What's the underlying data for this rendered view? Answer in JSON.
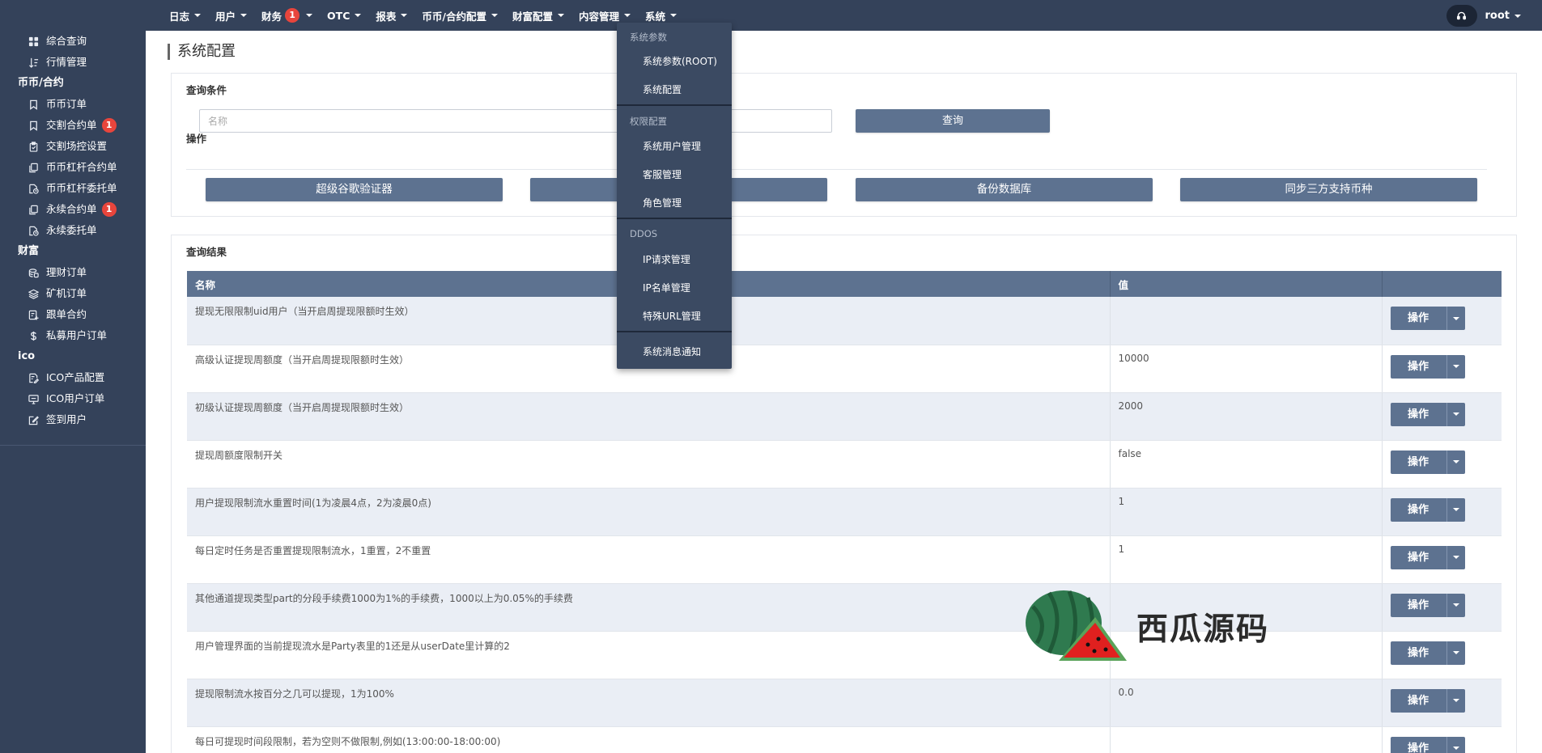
{
  "sidebar": {
    "items": [
      {
        "type": "item",
        "label": "综合查询",
        "icon": "dashboard-icon"
      },
      {
        "type": "item",
        "label": "行情管理",
        "icon": "sort-icon"
      },
      {
        "type": "section",
        "label": "币币/合约"
      },
      {
        "type": "item",
        "label": "币币订单",
        "icon": "bookmark-icon"
      },
      {
        "type": "item",
        "label": "交割合约单",
        "icon": "bookmark-icon",
        "badge": "1"
      },
      {
        "type": "item",
        "label": "交割场控设置",
        "icon": "clipboard-icon"
      },
      {
        "type": "item",
        "label": "币币杠杆合约单",
        "icon": "copy-icon"
      },
      {
        "type": "item",
        "label": "币币杠杆委托单",
        "icon": "file-clock-icon"
      },
      {
        "type": "item",
        "label": "永续合约单",
        "icon": "copy-icon",
        "badge": "1"
      },
      {
        "type": "item",
        "label": "永续委托单",
        "icon": "file-clock-icon"
      },
      {
        "type": "section",
        "label": "财富"
      },
      {
        "type": "item",
        "label": "理财订单",
        "icon": "coins-icon"
      },
      {
        "type": "item",
        "label": "矿机订单",
        "icon": "layers-icon"
      },
      {
        "type": "item",
        "label": "跟单合约",
        "icon": "file-plus-icon"
      },
      {
        "type": "item",
        "label": "私募用户订单",
        "icon": "dollar-icon"
      },
      {
        "type": "section",
        "label": "ico"
      },
      {
        "type": "item",
        "label": "ICO产品配置",
        "icon": "file-edit-icon"
      },
      {
        "type": "item",
        "label": "ICO用户订单",
        "icon": "monitor-icon"
      },
      {
        "type": "item",
        "label": "签到用户",
        "icon": "checkbox-edit-icon"
      }
    ]
  },
  "topnav": [
    {
      "label": "日志",
      "caret": true
    },
    {
      "label": "用户",
      "caret": true
    },
    {
      "label": "财务",
      "caret": true,
      "badge": "1"
    },
    {
      "label": "OTC",
      "caret": true
    },
    {
      "label": "报表",
      "caret": true
    },
    {
      "label": "币币/合约配置",
      "caret": true
    },
    {
      "label": "财富配置",
      "caret": true
    },
    {
      "label": "内容管理",
      "caret": true
    },
    {
      "label": "系统",
      "caret": true
    }
  ],
  "user": {
    "name": "root",
    "icon": "headset-icon"
  },
  "page": {
    "title": "系统配置"
  },
  "query": {
    "section_title": "查询条件",
    "placeholder": "名称",
    "query_button": "查询"
  },
  "operations": {
    "section_title": "操作",
    "buttons": [
      "超级谷歌验证器",
      "",
      "备份数据库",
      "同步三方支持币种"
    ]
  },
  "results": {
    "section_title": "查询结果",
    "columns": [
      "名称",
      "值",
      ""
    ],
    "action_label": "操作",
    "rows": [
      {
        "name": "提现无限限制uid用户（当开启周提现限额时生效）",
        "value": ""
      },
      {
        "name": "高级认证提现周额度（当开启周提现限额时生效）",
        "value": "10000"
      },
      {
        "name": "初级认证提现周额度（当开启周提现限额时生效）",
        "value": "2000"
      },
      {
        "name": "提现周额度限制开关",
        "value": "false"
      },
      {
        "name": "用户提现限制流水重置时间(1为凌晨4点，2为凌晨0点)",
        "value": "1"
      },
      {
        "name": "每日定时任务是否重置提现限制流水，1重置，2不重置",
        "value": "1"
      },
      {
        "name": "其他通道提现类型part的分段手续费1000为1%的手续费，1000以上为0.05%的手续费",
        "value": ""
      },
      {
        "name": "用户管理界面的当前提现流水是Party表里的1还是从userDate里计算的2",
        "value": ""
      },
      {
        "name": "提现限制流水按百分之几可以提现，1为100%",
        "value": "0.0"
      },
      {
        "name": "每日可提现时间段限制，若为空则不做限制,例如(13:00:00-18:00:00)",
        "value": ""
      }
    ]
  },
  "system_menu": {
    "groups": [
      {
        "header": "系统参数",
        "items": [
          "系统参数(ROOT)",
          "系统配置"
        ]
      },
      {
        "header": "权限配置",
        "items": [
          "系统用户管理",
          "客服管理",
          "角色管理"
        ]
      },
      {
        "header": "DDOS",
        "items": [
          "IP请求管理",
          "IP名单管理",
          "特殊URL管理"
        ]
      },
      {
        "header": "",
        "items": [
          "系统消息通知"
        ]
      }
    ]
  },
  "watermark": {
    "text": "西瓜源码"
  },
  "colors": {
    "sidebar_bg": "#34425a",
    "button_bg": "#5d7290",
    "badge": "#e8453c",
    "row_alt": "#eaeef5"
  }
}
